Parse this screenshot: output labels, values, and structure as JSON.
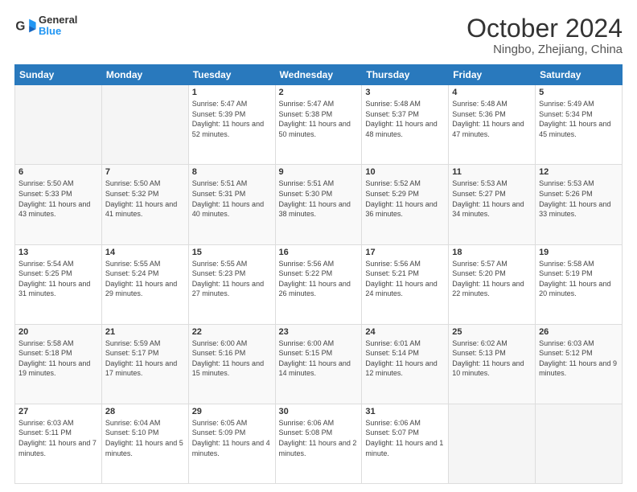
{
  "logo": {
    "text_general": "General",
    "text_blue": "Blue"
  },
  "header": {
    "month": "October 2024",
    "location": "Ningbo, Zhejiang, China"
  },
  "weekdays": [
    "Sunday",
    "Monday",
    "Tuesday",
    "Wednesday",
    "Thursday",
    "Friday",
    "Saturday"
  ],
  "weeks": [
    [
      {
        "day": "",
        "sunrise": "",
        "sunset": "",
        "daylight": ""
      },
      {
        "day": "",
        "sunrise": "",
        "sunset": "",
        "daylight": ""
      },
      {
        "day": "1",
        "sunrise": "Sunrise: 5:47 AM",
        "sunset": "Sunset: 5:39 PM",
        "daylight": "Daylight: 11 hours and 52 minutes."
      },
      {
        "day": "2",
        "sunrise": "Sunrise: 5:47 AM",
        "sunset": "Sunset: 5:38 PM",
        "daylight": "Daylight: 11 hours and 50 minutes."
      },
      {
        "day": "3",
        "sunrise": "Sunrise: 5:48 AM",
        "sunset": "Sunset: 5:37 PM",
        "daylight": "Daylight: 11 hours and 48 minutes."
      },
      {
        "day": "4",
        "sunrise": "Sunrise: 5:48 AM",
        "sunset": "Sunset: 5:36 PM",
        "daylight": "Daylight: 11 hours and 47 minutes."
      },
      {
        "day": "5",
        "sunrise": "Sunrise: 5:49 AM",
        "sunset": "Sunset: 5:34 PM",
        "daylight": "Daylight: 11 hours and 45 minutes."
      }
    ],
    [
      {
        "day": "6",
        "sunrise": "Sunrise: 5:50 AM",
        "sunset": "Sunset: 5:33 PM",
        "daylight": "Daylight: 11 hours and 43 minutes."
      },
      {
        "day": "7",
        "sunrise": "Sunrise: 5:50 AM",
        "sunset": "Sunset: 5:32 PM",
        "daylight": "Daylight: 11 hours and 41 minutes."
      },
      {
        "day": "8",
        "sunrise": "Sunrise: 5:51 AM",
        "sunset": "Sunset: 5:31 PM",
        "daylight": "Daylight: 11 hours and 40 minutes."
      },
      {
        "day": "9",
        "sunrise": "Sunrise: 5:51 AM",
        "sunset": "Sunset: 5:30 PM",
        "daylight": "Daylight: 11 hours and 38 minutes."
      },
      {
        "day": "10",
        "sunrise": "Sunrise: 5:52 AM",
        "sunset": "Sunset: 5:29 PM",
        "daylight": "Daylight: 11 hours and 36 minutes."
      },
      {
        "day": "11",
        "sunrise": "Sunrise: 5:53 AM",
        "sunset": "Sunset: 5:27 PM",
        "daylight": "Daylight: 11 hours and 34 minutes."
      },
      {
        "day": "12",
        "sunrise": "Sunrise: 5:53 AM",
        "sunset": "Sunset: 5:26 PM",
        "daylight": "Daylight: 11 hours and 33 minutes."
      }
    ],
    [
      {
        "day": "13",
        "sunrise": "Sunrise: 5:54 AM",
        "sunset": "Sunset: 5:25 PM",
        "daylight": "Daylight: 11 hours and 31 minutes."
      },
      {
        "day": "14",
        "sunrise": "Sunrise: 5:55 AM",
        "sunset": "Sunset: 5:24 PM",
        "daylight": "Daylight: 11 hours and 29 minutes."
      },
      {
        "day": "15",
        "sunrise": "Sunrise: 5:55 AM",
        "sunset": "Sunset: 5:23 PM",
        "daylight": "Daylight: 11 hours and 27 minutes."
      },
      {
        "day": "16",
        "sunrise": "Sunrise: 5:56 AM",
        "sunset": "Sunset: 5:22 PM",
        "daylight": "Daylight: 11 hours and 26 minutes."
      },
      {
        "day": "17",
        "sunrise": "Sunrise: 5:56 AM",
        "sunset": "Sunset: 5:21 PM",
        "daylight": "Daylight: 11 hours and 24 minutes."
      },
      {
        "day": "18",
        "sunrise": "Sunrise: 5:57 AM",
        "sunset": "Sunset: 5:20 PM",
        "daylight": "Daylight: 11 hours and 22 minutes."
      },
      {
        "day": "19",
        "sunrise": "Sunrise: 5:58 AM",
        "sunset": "Sunset: 5:19 PM",
        "daylight": "Daylight: 11 hours and 20 minutes."
      }
    ],
    [
      {
        "day": "20",
        "sunrise": "Sunrise: 5:58 AM",
        "sunset": "Sunset: 5:18 PM",
        "daylight": "Daylight: 11 hours and 19 minutes."
      },
      {
        "day": "21",
        "sunrise": "Sunrise: 5:59 AM",
        "sunset": "Sunset: 5:17 PM",
        "daylight": "Daylight: 11 hours and 17 minutes."
      },
      {
        "day": "22",
        "sunrise": "Sunrise: 6:00 AM",
        "sunset": "Sunset: 5:16 PM",
        "daylight": "Daylight: 11 hours and 15 minutes."
      },
      {
        "day": "23",
        "sunrise": "Sunrise: 6:00 AM",
        "sunset": "Sunset: 5:15 PM",
        "daylight": "Daylight: 11 hours and 14 minutes."
      },
      {
        "day": "24",
        "sunrise": "Sunrise: 6:01 AM",
        "sunset": "Sunset: 5:14 PM",
        "daylight": "Daylight: 11 hours and 12 minutes."
      },
      {
        "day": "25",
        "sunrise": "Sunrise: 6:02 AM",
        "sunset": "Sunset: 5:13 PM",
        "daylight": "Daylight: 11 hours and 10 minutes."
      },
      {
        "day": "26",
        "sunrise": "Sunrise: 6:03 AM",
        "sunset": "Sunset: 5:12 PM",
        "daylight": "Daylight: 11 hours and 9 minutes."
      }
    ],
    [
      {
        "day": "27",
        "sunrise": "Sunrise: 6:03 AM",
        "sunset": "Sunset: 5:11 PM",
        "daylight": "Daylight: 11 hours and 7 minutes."
      },
      {
        "day": "28",
        "sunrise": "Sunrise: 6:04 AM",
        "sunset": "Sunset: 5:10 PM",
        "daylight": "Daylight: 11 hours and 5 minutes."
      },
      {
        "day": "29",
        "sunrise": "Sunrise: 6:05 AM",
        "sunset": "Sunset: 5:09 PM",
        "daylight": "Daylight: 11 hours and 4 minutes."
      },
      {
        "day": "30",
        "sunrise": "Sunrise: 6:06 AM",
        "sunset": "Sunset: 5:08 PM",
        "daylight": "Daylight: 11 hours and 2 minutes."
      },
      {
        "day": "31",
        "sunrise": "Sunrise: 6:06 AM",
        "sunset": "Sunset: 5:07 PM",
        "daylight": "Daylight: 11 hours and 1 minute."
      },
      {
        "day": "",
        "sunrise": "",
        "sunset": "",
        "daylight": ""
      },
      {
        "day": "",
        "sunrise": "",
        "sunset": "",
        "daylight": ""
      }
    ]
  ]
}
